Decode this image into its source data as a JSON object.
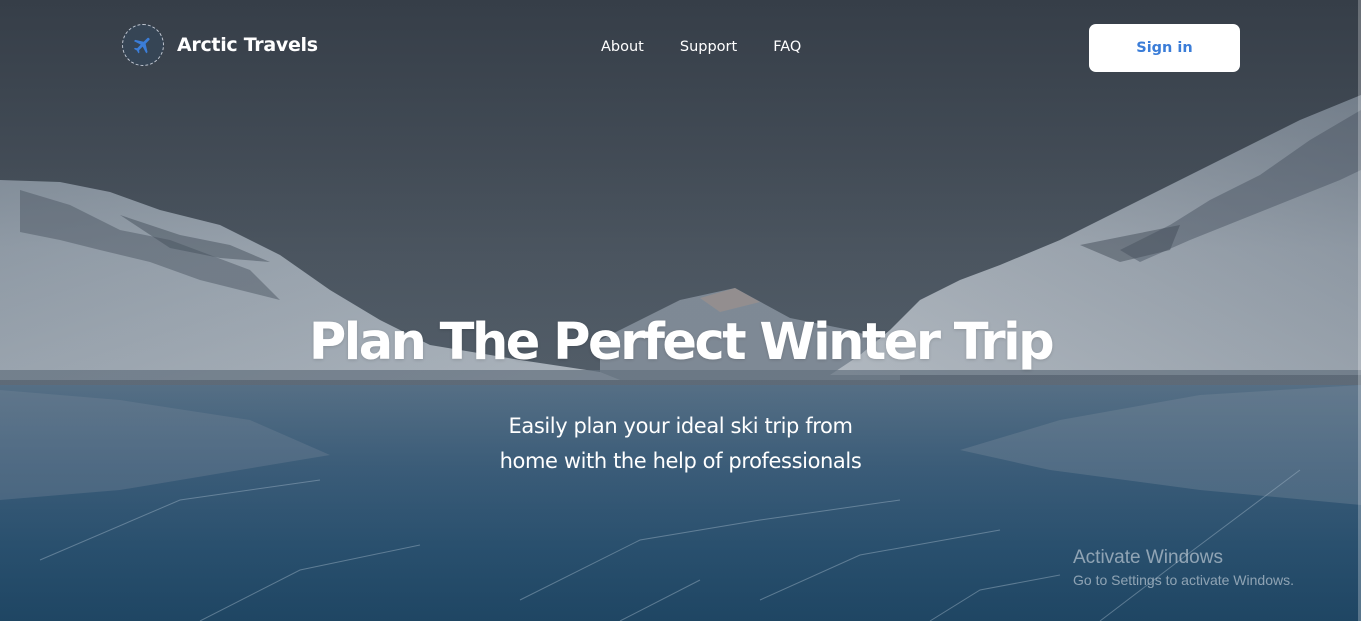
{
  "brand": {
    "name": "Arctic Travels",
    "icon": "airplane-icon"
  },
  "nav": {
    "about": "About",
    "support": "Support",
    "faq": "FAQ"
  },
  "header": {
    "signin_label": "Sign in"
  },
  "hero": {
    "headline": "Plan The Perfect Winter Trip",
    "sub_line_1": "Easily plan your ideal ski trip from",
    "sub_line_2": "home with the help of professionals"
  },
  "watermark": {
    "title": "Activate Windows",
    "subtitle": "Go to Settings to activate Windows."
  },
  "colors": {
    "accent": "#3b7dd8",
    "text": "#ffffff",
    "sky": "#3c4752",
    "ice": "#2f5a7a"
  }
}
